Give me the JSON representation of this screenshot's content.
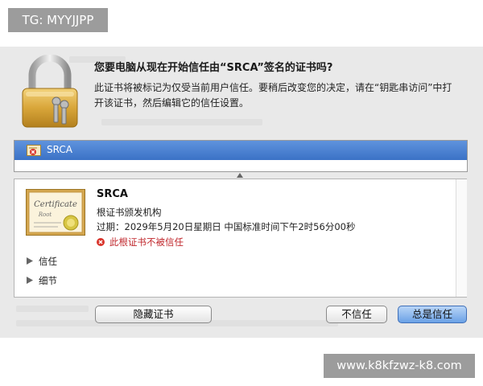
{
  "overlay": {
    "tag_top_left": "TG: MYYJJPP",
    "tag_bottom_right": "www.k8kfzwz-k8.com"
  },
  "dialog": {
    "title": "您要电脑从现在开始信任由“SRCA”签名的证书吗?",
    "description_line1": "此证书将被标记为仅受当前用户信任。要稍后改变您的决定，请在“钥匙串访问”中打",
    "description_line2": "开该证书，然后编辑它的信任设置。"
  },
  "cert_list": {
    "selected_item": "SRCA"
  },
  "certificate": {
    "image_text": "Certificate",
    "image_subtext": "Root",
    "name": "SRCA",
    "issuer_type": "根证书颁发机构",
    "expiry": "过期：2029年5月20日星期日 中国标准时间下午2时56分00秒",
    "status": "此根证书不被信任"
  },
  "sections": {
    "trust": "信任",
    "details": "细节"
  },
  "buttons": {
    "hide_certificate": "隐藏证书",
    "dont_trust": "不信任",
    "always_trust": "总是信任"
  },
  "colors": {
    "selection": "#3b72c6",
    "error": "#c0282d",
    "default_button": "#6aa1e6",
    "dialog_background": "#e9e9e9"
  },
  "icons": [
    "padlock-icon",
    "certificate-error-icon",
    "error-icon",
    "disclosure-triangle-icon"
  ]
}
